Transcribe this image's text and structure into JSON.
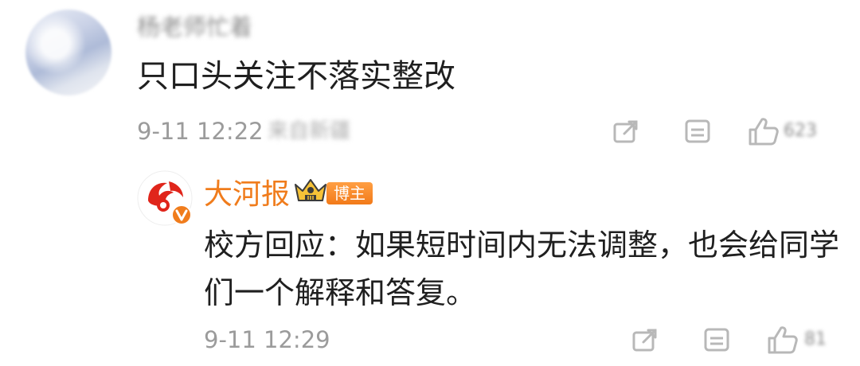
{
  "comment": {
    "username": "杨老师忙着",
    "text": "只口头关注不落实整改",
    "time": "9-11 12:22",
    "location": "来自新疆",
    "like_count": "623",
    "icons": [
      "share-icon",
      "comment-icon",
      "like-icon"
    ]
  },
  "reply": {
    "username": "大河报",
    "badge": "博主",
    "text": "校方回应：如果短时间内无法调整，也会给同学们一个解释和答复。",
    "time": "9-11 12:29",
    "like_count": "81",
    "accent_color": "#f07c1c",
    "icons": [
      "share-icon",
      "comment-icon",
      "like-icon"
    ]
  }
}
